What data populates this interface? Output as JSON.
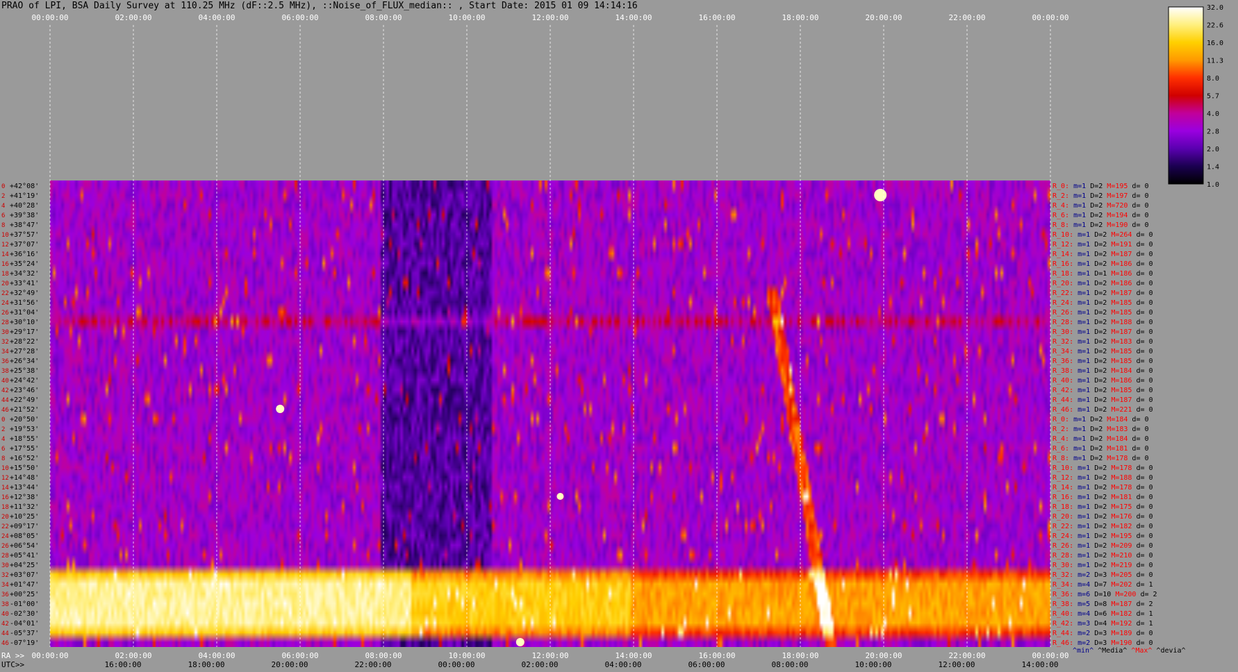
{
  "title": "PRAO of LPI, BSA Daily Survey at 110.25 MHz (dF::2.5 MHz), ::Noise_of_FLUX_median:: , Start Date: 2015 01 09 14:14:16",
  "chart_data": {
    "type": "heatmap",
    "title": "PRAO of LPI, BSA Daily Survey at 110.25 MHz (dF::2.5 MHz), ::Noise_of_FLUX_median:: , Start Date: 2015 01 09 14:14:16",
    "x_top_ticks": [
      "00:00:00",
      "02:00:00",
      "04:00:00",
      "06:00:00",
      "08:00:00",
      "10:00:00",
      "12:00:00",
      "14:00:00",
      "16:00:00",
      "18:00:00",
      "20:00:00",
      "22:00:00",
      "00:00:00"
    ],
    "x_bottom_ra_label": "RA >>",
    "x_bottom_ra_ticks": [
      "00:00:00",
      "02:00:00",
      "04:00:00",
      "06:00:00",
      "08:00:00",
      "10:00:00",
      "12:00:00",
      "14:00:00",
      "16:00:00",
      "18:00:00",
      "20:00:00",
      "22:00:00",
      "00:00:00"
    ],
    "x_bottom_utc_label": "UTC>>",
    "x_bottom_utc_ticks": [
      "16:00:00",
      "18:00:00",
      "20:00:00",
      "22:00:00",
      "00:00:00",
      "02:00:00",
      "04:00:00",
      "06:00:00",
      "08:00:00",
      "10:00:00",
      "12:00:00",
      "14:00:00"
    ],
    "y_ticks": [
      "+42°08'",
      "+41°19'",
      "+40°28'",
      "+39°38'",
      "+38°47'",
      "+37°57'",
      "+37°07'",
      "+36°16'",
      "+35°24'",
      "+34°32'",
      "+33°41'",
      "+32°49'",
      "+31°56'",
      "+31°04'",
      "+30°10'",
      "+29°17'",
      "+28°22'",
      "+27°28'",
      "+26°34'",
      "+25°38'",
      "+24°42'",
      "+23°46'",
      "+22°49'",
      "+21°52'",
      "+20°50'",
      "+19°53'",
      "+18°55'",
      "+17°55'",
      "+16°52'",
      "+15°50'",
      "+14°48'",
      "+13°44'",
      "+12°38'",
      "+11°32'",
      "+10°25'",
      "+09°17'",
      "+08°05'",
      "+06°54'",
      "+05°41'",
      "+04°25'",
      "+03°07'",
      "+01°47'",
      "+00°25'",
      "-01°00'",
      "-02°30'",
      "-04°01'",
      "-05°37'",
      "-07°19'"
    ],
    "row_numbers": [
      "0",
      "2",
      "4",
      "6",
      "8",
      "10",
      "12",
      "14",
      "16",
      "18",
      "20",
      "22",
      "24",
      "26",
      "28",
      "30",
      "32",
      "34",
      "36",
      "38",
      "40",
      "42",
      "44",
      "46",
      "0",
      "2",
      "4",
      "6",
      "8",
      "10",
      "12",
      "14",
      "16",
      "18",
      "20",
      "22",
      "24",
      "26",
      "28",
      "30",
      "32",
      "34",
      "36",
      "38",
      "40",
      "42",
      "44",
      "46"
    ],
    "colorbar": {
      "ticks": [
        "32.0",
        "22.6",
        "16.0",
        "11.3",
        "8.0",
        "5.7",
        "4.0",
        "2.8",
        "2.0",
        "1.4",
        "1.0"
      ],
      "scale": "log",
      "colors": [
        "#ffffff",
        "#fff080",
        "#ffd000",
        "#ff9a00",
        "#ff3000",
        "#d00000",
        "#c2009a",
        "#9a00e0",
        "#5a00b0",
        "#1a0050",
        "#000000"
      ]
    },
    "right_stats": [
      {
        "R": "R_0:",
        "m": "m=1",
        "D": "D=2",
        "M": "M=195",
        "d": "d= 0"
      },
      {
        "R": "R_2:",
        "m": "m=1",
        "D": "D=2",
        "M": "M=197",
        "d": "d= 0"
      },
      {
        "R": "R_4:",
        "m": "m=1",
        "D": "D=2",
        "M": "M=720",
        "d": "d= 0"
      },
      {
        "R": "R_6:",
        "m": "m=1",
        "D": "D=2",
        "M": "M=194",
        "d": "d= 0"
      },
      {
        "R": "R_8:",
        "m": "m=1",
        "D": "D=2",
        "M": "M=190",
        "d": "d= 0"
      },
      {
        "R": "R_10:",
        "m": "m=1",
        "D": "D=2",
        "M": "M=264",
        "d": "d= 0"
      },
      {
        "R": "R_12:",
        "m": "m=1",
        "D": "D=2",
        "M": "M=191",
        "d": "d= 0"
      },
      {
        "R": "R_14:",
        "m": "m=1",
        "D": "D=2",
        "M": "M=187",
        "d": "d= 0"
      },
      {
        "R": "R_16:",
        "m": "m=1",
        "D": "D=2",
        "M": "M=186",
        "d": "d= 0"
      },
      {
        "R": "R_18:",
        "m": "m=1",
        "D": "D=1",
        "M": "M=186",
        "d": "d= 0"
      },
      {
        "R": "R_20:",
        "m": "m=1",
        "D": "D=2",
        "M": "M=186",
        "d": "d= 0"
      },
      {
        "R": "R_22:",
        "m": "m=1",
        "D": "D=2",
        "M": "M=187",
        "d": "d= 0"
      },
      {
        "R": "R_24:",
        "m": "m=1",
        "D": "D=2",
        "M": "M=185",
        "d": "d= 0"
      },
      {
        "R": "R_26:",
        "m": "m=1",
        "D": "D=2",
        "M": "M=185",
        "d": "d= 0"
      },
      {
        "R": "R_28:",
        "m": "m=1",
        "D": "D=2",
        "M": "M=188",
        "d": "d= 0"
      },
      {
        "R": "R_30:",
        "m": "m=1",
        "D": "D=2",
        "M": "M=187",
        "d": "d= 0"
      },
      {
        "R": "R_32:",
        "m": "m=1",
        "D": "D=2",
        "M": "M=183",
        "d": "d= 0"
      },
      {
        "R": "R_34:",
        "m": "m=1",
        "D": "D=2",
        "M": "M=185",
        "d": "d= 0"
      },
      {
        "R": "R_36:",
        "m": "m=1",
        "D": "D=2",
        "M": "M=185",
        "d": "d= 0"
      },
      {
        "R": "R_38:",
        "m": "m=1",
        "D": "D=2",
        "M": "M=184",
        "d": "d= 0"
      },
      {
        "R": "R_40:",
        "m": "m=1",
        "D": "D=2",
        "M": "M=186",
        "d": "d= 0"
      },
      {
        "R": "R_42:",
        "m": "m=1",
        "D": "D=2",
        "M": "M=185",
        "d": "d= 0"
      },
      {
        "R": "R_44:",
        "m": "m=1",
        "D": "D=2",
        "M": "M=187",
        "d": "d= 0"
      },
      {
        "R": "R_46:",
        "m": "m=1",
        "D": "D=2",
        "M": "M=221",
        "d": "d= 0"
      },
      {
        "R": "R_0:",
        "m": "m=1",
        "D": "D=2",
        "M": "M=184",
        "d": "d= 0"
      },
      {
        "R": "R_2:",
        "m": "m=1",
        "D": "D=2",
        "M": "M=183",
        "d": "d= 0"
      },
      {
        "R": "R_4:",
        "m": "m=1",
        "D": "D=2",
        "M": "M=184",
        "d": "d= 0"
      },
      {
        "R": "R_6:",
        "m": "m=1",
        "D": "D=2",
        "M": "M=181",
        "d": "d= 0"
      },
      {
        "R": "R_8:",
        "m": "m=1",
        "D": "D=2",
        "M": "M=178",
        "d": "d= 0"
      },
      {
        "R": "R_10:",
        "m": "m=1",
        "D": "D=2",
        "M": "M=178",
        "d": "d= 0"
      },
      {
        "R": "R_12:",
        "m": "m=1",
        "D": "D=2",
        "M": "M=188",
        "d": "d= 0"
      },
      {
        "R": "R_14:",
        "m": "m=1",
        "D": "D=2",
        "M": "M=178",
        "d": "d= 0"
      },
      {
        "R": "R_16:",
        "m": "m=1",
        "D": "D=2",
        "M": "M=181",
        "d": "d= 0"
      },
      {
        "R": "R_18:",
        "m": "m=1",
        "D": "D=2",
        "M": "M=175",
        "d": "d= 0"
      },
      {
        "R": "R_20:",
        "m": "m=1",
        "D": "D=2",
        "M": "M=176",
        "d": "d= 0"
      },
      {
        "R": "R_22:",
        "m": "m=1",
        "D": "D=2",
        "M": "M=182",
        "d": "d= 0"
      },
      {
        "R": "R_24:",
        "m": "m=1",
        "D": "D=2",
        "M": "M=195",
        "d": "d= 0"
      },
      {
        "R": "R_26:",
        "m": "m=1",
        "D": "D=2",
        "M": "M=209",
        "d": "d= 0"
      },
      {
        "R": "R_28:",
        "m": "m=1",
        "D": "D=2",
        "M": "M=210",
        "d": "d= 0"
      },
      {
        "R": "R_30:",
        "m": "m=1",
        "D": "D=2",
        "M": "M=219",
        "d": "d= 0"
      },
      {
        "R": "R_32:",
        "m": "m=2",
        "D": "D=3",
        "M": "M=205",
        "d": "d= 0"
      },
      {
        "R": "R_34:",
        "m": "m=4",
        "D": "D=7",
        "M": "M=202",
        "d": "d= 1"
      },
      {
        "R": "R_36:",
        "m": "m=6",
        "D": "D=10",
        "M": "M=200",
        "d": "d= 2"
      },
      {
        "R": "R_38:",
        "m": "m=5",
        "D": "D=8",
        "M": "M=187",
        "d": "d= 2"
      },
      {
        "R": "R_40:",
        "m": "m=4",
        "D": "D=6",
        "M": "M=182",
        "d": "d= 1"
      },
      {
        "R": "R_42:",
        "m": "m=3",
        "D": "D=4",
        "M": "M=192",
        "d": "d= 1"
      },
      {
        "R": "R_44:",
        "m": "m=2",
        "D": "D=3",
        "M": "M=189",
        "d": "d= 0"
      },
      {
        "R": "R_46:",
        "m": "m=2",
        "D": "D=3",
        "M": "M=190",
        "d": "d= 0"
      }
    ],
    "stats_legend": [
      "^min^",
      "^Media^",
      "^Max^",
      "^devia^"
    ],
    "stats_legend_colors": [
      "#00008b",
      "#000000",
      "#ff0000",
      "#000000"
    ]
  }
}
